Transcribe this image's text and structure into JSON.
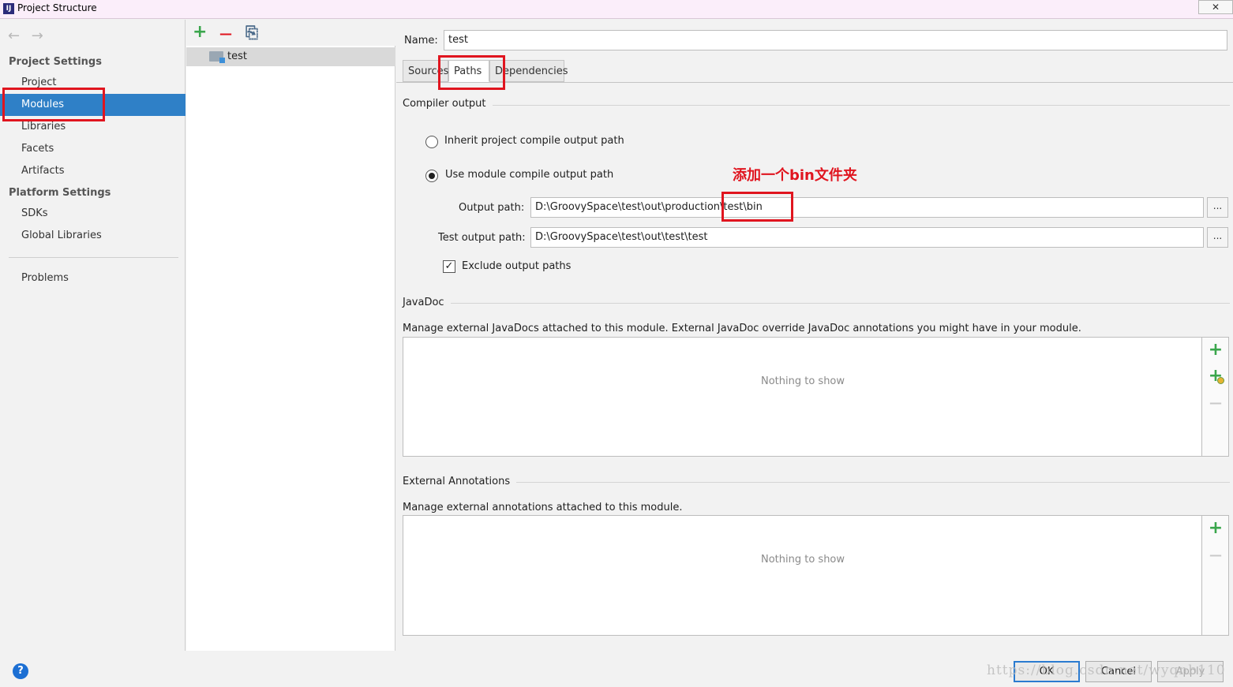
{
  "window": {
    "title": "Project Structure",
    "close_glyph": "✕",
    "icon_label": "IJ"
  },
  "nav": {
    "back_icon": "←",
    "forward_icon": "→",
    "project_settings_title": "Project Settings",
    "project_settings_items": [
      "Project",
      "Modules",
      "Libraries",
      "Facets",
      "Artifacts"
    ],
    "platform_settings_title": "Platform Settings",
    "platform_settings_items": [
      "SDKs",
      "Global Libraries"
    ],
    "problems": "Problems",
    "selected": "Modules"
  },
  "modules_toolbar": {
    "add_glyph": "+",
    "remove_glyph": "—",
    "copy_glyph": "⎘"
  },
  "modules_list": [
    "test"
  ],
  "module": {
    "name_label": "Name:",
    "name_value": "test",
    "tabs": [
      "Sources",
      "Paths",
      "Dependencies"
    ],
    "active_tab": "Paths"
  },
  "compiler_output": {
    "title": "Compiler output",
    "inherit_label": "Inherit project compile output path",
    "use_module_label": "Use module compile output path",
    "selected_option": "use_module",
    "output_path_label": "Output path:",
    "output_path_value": "D:\\GroovySpace\\test\\out\\production\\test\\bin",
    "test_output_path_label": "Test output path:",
    "test_output_path_value": "D:\\GroovySpace\\test\\out\\test\\test",
    "browse_label": "...",
    "exclude_label": "Exclude output paths",
    "exclude_checked": true,
    "check_glyph": "✓"
  },
  "annotation": {
    "text": "添加一个bin文件夹",
    "color": "#e0151f"
  },
  "javadoc": {
    "title": "JavaDoc",
    "description": "Manage external JavaDocs attached to this module. External JavaDoc override JavaDoc annotations you might have in your module.",
    "empty_text": "Nothing to show",
    "add_glyph": "+",
    "remove_glyph": "—"
  },
  "external_annotations": {
    "title": "External Annotations",
    "description": "Manage external annotations attached to this module.",
    "empty_text": "Nothing to show",
    "add_glyph": "+",
    "remove_glyph": "—"
  },
  "footer": {
    "help_glyph": "?",
    "ok_label": "OK",
    "cancel_label": "Cancel",
    "apply_label": "Apply",
    "watermark": "https://blog.csdn.net/wyqnb110"
  },
  "colors": {
    "selection": "#2f80c7",
    "highlight_box": "#e0151f",
    "add_green": "#3aa64c",
    "remove_red": "#e0151f"
  }
}
